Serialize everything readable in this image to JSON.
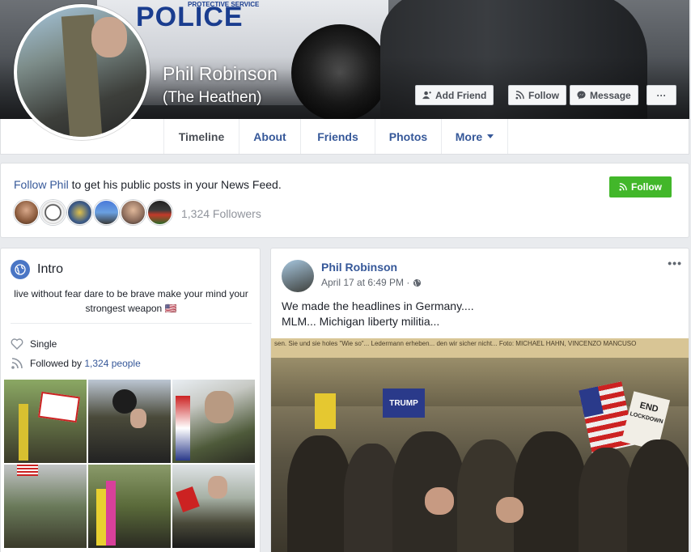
{
  "cover": {
    "police_text": "POLICE",
    "service_text": "PROTECTIVE SERVICE"
  },
  "profile": {
    "name": "Phil Robinson",
    "alternate_name": "(The Heathen)"
  },
  "actions": {
    "add_friend": "Add Friend",
    "follow": "Follow",
    "message": "Message",
    "more": "···"
  },
  "nav": {
    "tabs": [
      {
        "label": "Timeline"
      },
      {
        "label": "About"
      },
      {
        "label": "Friends"
      },
      {
        "label": "Photos"
      },
      {
        "label": "More"
      }
    ]
  },
  "follow_card": {
    "link": "Follow Phil",
    "text": " to get his public posts in your News Feed.",
    "followers": "1,324 Followers",
    "button": "Follow"
  },
  "intro": {
    "title": "Intro",
    "bio": "live without fear dare to be brave make your mind your strongest weapon 🇺🇸",
    "relationship": "Single",
    "followed_prefix": "Followed by ",
    "followed_link": "1,324 people"
  },
  "post": {
    "author": "Phil Robinson",
    "date": "April 17 at 6:49 PM ·",
    "more": "•••",
    "line1": "We made the headlines in Germany....",
    "line2": "MLM... Michigan liberty militia...",
    "image_headline": "sen. Sie und sie holes \"Wie so\"... Ledermann erheben... den wir sicher nicht... Foto: MICHAEL HAHN, VINCENZO MANCUSO",
    "sign_trump": "TRUMP",
    "sign_end": "END",
    "sign_lockdown": "LOCKDOWN"
  },
  "colors": {
    "link": "#365899",
    "green": "#42b72a",
    "background": "#e9ebee"
  },
  "icons": [
    "add-friend-icon",
    "rss-icon",
    "messenger-icon",
    "globe-icon",
    "heart-icon",
    "followers-icon",
    "public-globe-icon"
  ]
}
